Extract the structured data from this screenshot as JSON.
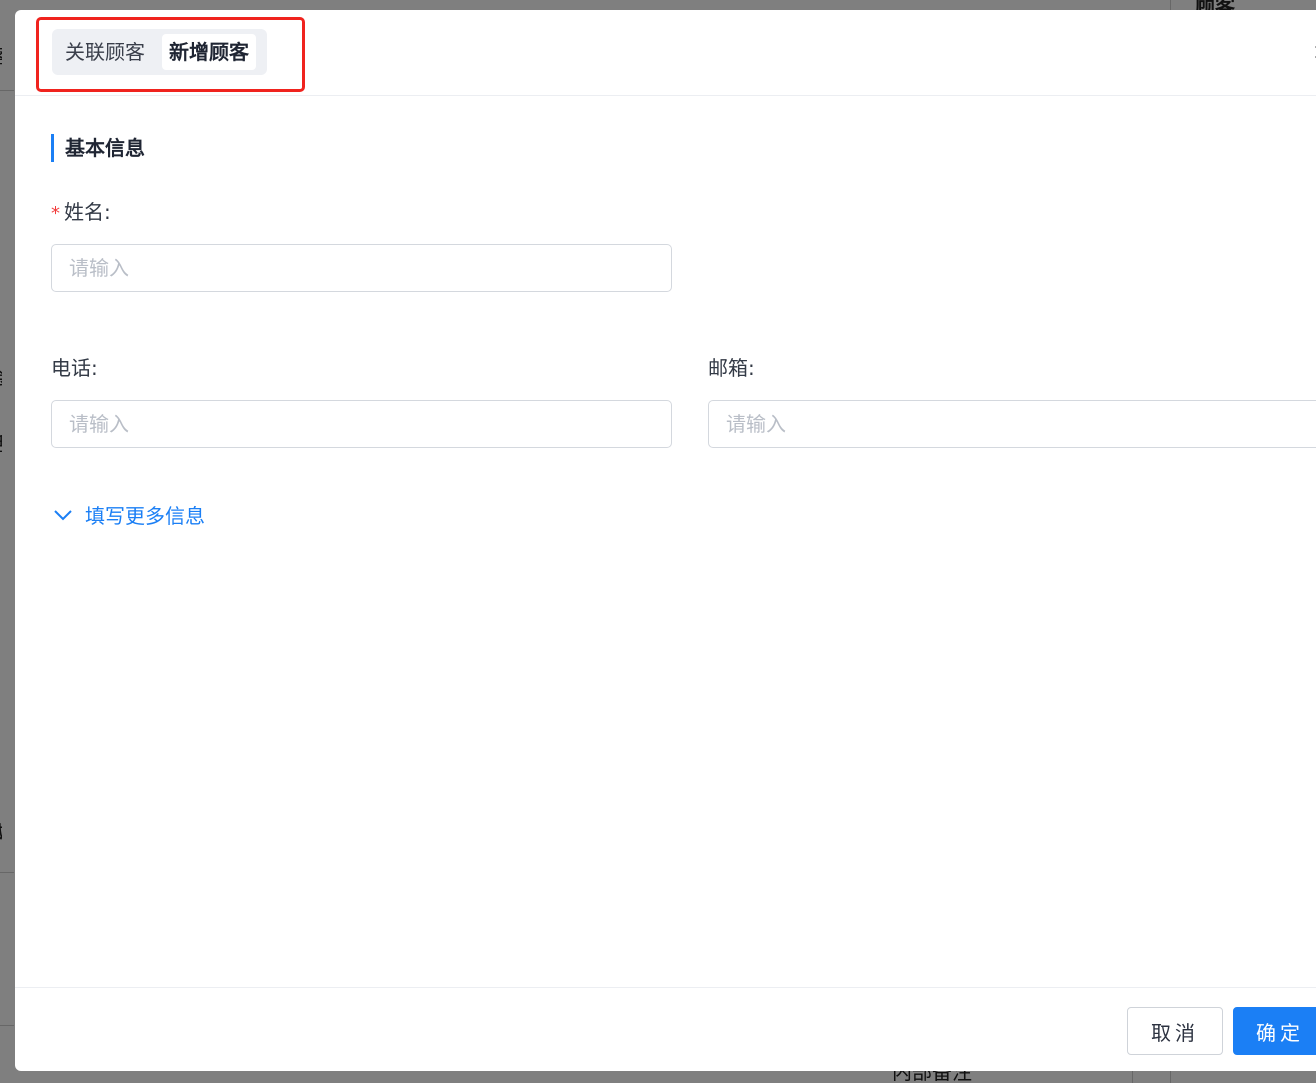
{
  "background": {
    "fragments_left": [
      "客服",
      "会话",
      "话",
      "或"
    ],
    "right_title": "顾客",
    "bottom_text": "内部备注"
  },
  "modal": {
    "tabs": [
      {
        "label": "关联顾客",
        "active": false
      },
      {
        "label": "新增顾客",
        "active": true
      }
    ],
    "close_icon": "×",
    "section_title": "基本信息",
    "fields": {
      "name": {
        "label": "姓名:",
        "required_mark": "*",
        "placeholder": "请输入",
        "value": ""
      },
      "phone": {
        "label": "电话:",
        "placeholder": "请输入",
        "value": ""
      },
      "email": {
        "label": "邮箱:",
        "placeholder": "请输入",
        "value": ""
      }
    },
    "more_info_link": "填写更多信息",
    "footer": {
      "cancel_label": "取消",
      "confirm_label": "确定"
    }
  },
  "colors": {
    "accent": "#1b7ff5",
    "required": "#f23c3c",
    "highlight": "#f0231e"
  }
}
